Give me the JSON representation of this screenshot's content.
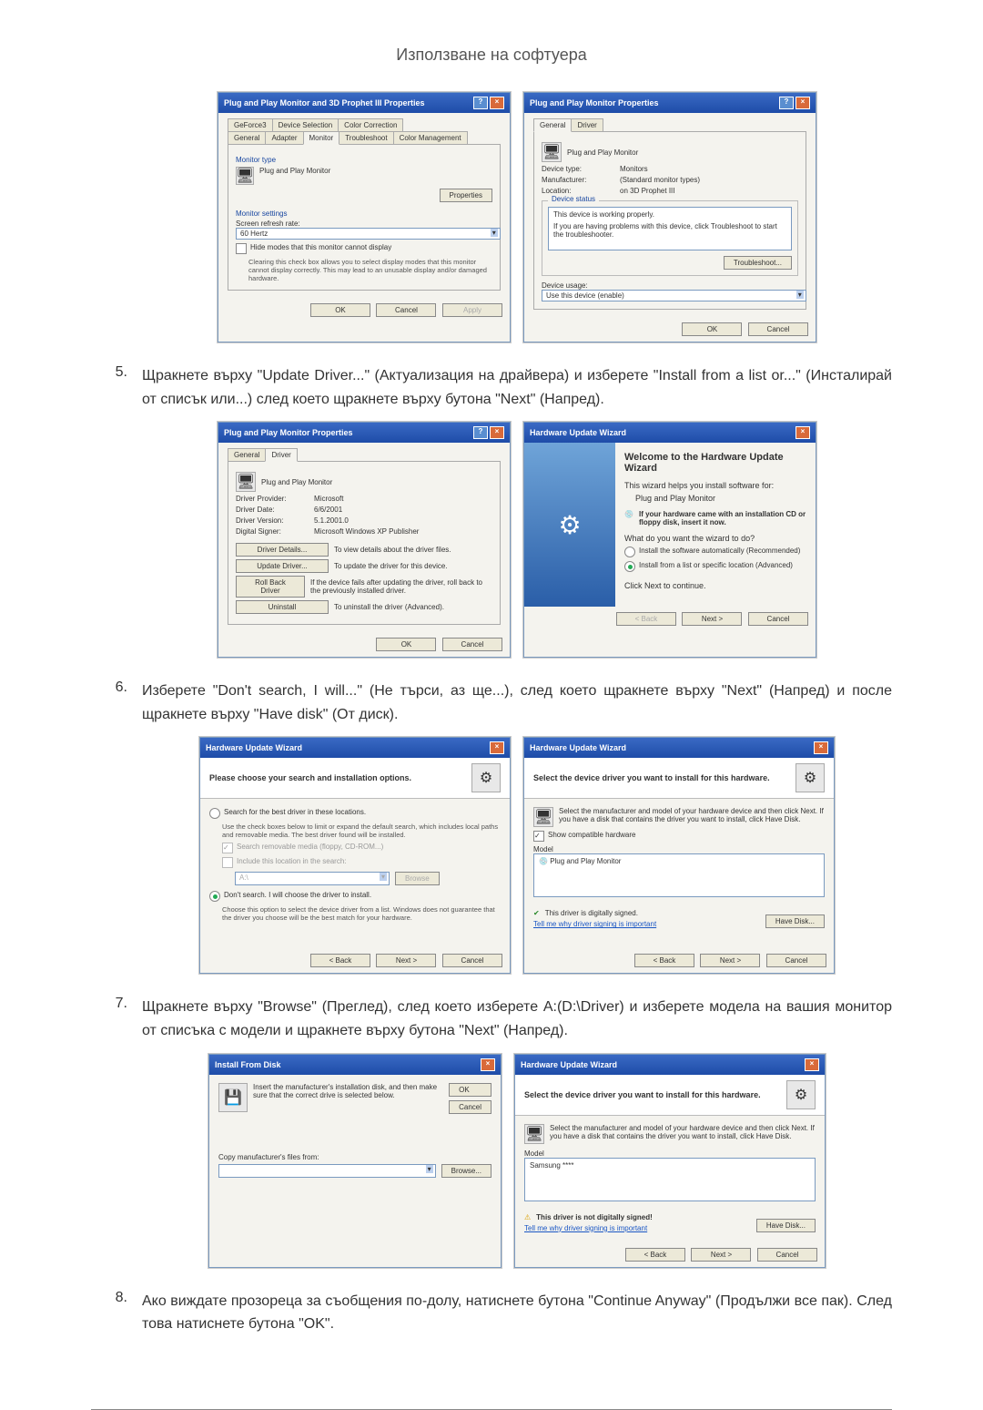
{
  "page_title": "Използване на софтуера",
  "step5": {
    "num": "5.",
    "text": "Щракнете върху \"Update Driver...\" (Актуализация на драйвера) и изберете \"Install from a list or...\" (Инсталирай от списък или...) след което щракнете върху бутона \"Next\" (Напред)."
  },
  "step6": {
    "num": "6.",
    "text": "Изберете \"Don't search, I will...\" (Не търси, аз ще...), след което щракнете върху \"Next\" (Напред) и после щракнете върху \"Have disk\" (От диск)."
  },
  "step7": {
    "num": "7.",
    "text": "Щракнете върху \"Browse\" (Преглед), след което изберете A:(D:\\Driver) и изберете модела на вашия монитор от списъка с модели и щракнете върху бутона \"Next\" (Напред)."
  },
  "step8": {
    "num": "8.",
    "text": "Ако виждате прозореца за съобщения по-долу, натиснете бутона \"Continue Anyway\" (Продължи все пак). След това натиснете бутона \"OK\"."
  },
  "dlg1a": {
    "title": "Plug and Play Monitor and 3D Prophet III Properties",
    "tabs": {
      "geforce": "GeForce3",
      "devsel": "Device Selection",
      "colorcorr": "Color Correction",
      "general": "General",
      "adapter": "Adapter",
      "monitor": "Monitor",
      "troubleshoot": "Troubleshoot",
      "colormgmt": "Color Management"
    },
    "monitor_type_label": "Monitor type",
    "monitor_name": "Plug and Play Monitor",
    "properties_btn": "Properties",
    "monitor_settings_label": "Monitor settings",
    "refresh_label": "Screen refresh rate:",
    "refresh_value": "60 Hertz",
    "hide_modes": "Hide modes that this monitor cannot display",
    "hide_modes_help": "Clearing this check box allows you to select display modes that this monitor cannot display correctly. This may lead to an unusable display and/or damaged hardware.",
    "ok": "OK",
    "cancel": "Cancel",
    "apply": "Apply"
  },
  "dlg1b": {
    "title": "Plug and Play Monitor Properties",
    "tabs": {
      "general": "General",
      "driver": "Driver"
    },
    "name": "Plug and Play Monitor",
    "devtype_l": "Device type:",
    "devtype_v": "Monitors",
    "manu_l": "Manufacturer:",
    "manu_v": "(Standard monitor types)",
    "loc_l": "Location:",
    "loc_v": "on 3D Prophet III",
    "status_label": "Device status",
    "status1": "This device is working properly.",
    "status2": "If you are having problems with this device, click Troubleshoot to start the troubleshooter.",
    "troubleshoot_btn": "Troubleshoot...",
    "usage_label": "Device usage:",
    "usage_value": "Use this device (enable)",
    "ok": "OK",
    "cancel": "Cancel"
  },
  "dlg2a": {
    "title": "Plug and Play Monitor Properties",
    "tabs": {
      "general": "General",
      "driver": "Driver"
    },
    "name": "Plug and Play Monitor",
    "prov_l": "Driver Provider:",
    "prov_v": "Microsoft",
    "date_l": "Driver Date:",
    "date_v": "6/6/2001",
    "ver_l": "Driver Version:",
    "ver_v": "5.1.2001.0",
    "sign_l": "Digital Signer:",
    "sign_v": "Microsoft Windows XP Publisher",
    "details_btn": "Driver Details...",
    "details_txt": "To view details about the driver files.",
    "update_btn": "Update Driver...",
    "update_txt": "To update the driver for this device.",
    "rollback_btn": "Roll Back Driver",
    "rollback_txt": "If the device fails after updating the driver, roll back to the previously installed driver.",
    "uninstall_btn": "Uninstall",
    "uninstall_txt": "To uninstall the driver (Advanced).",
    "ok": "OK",
    "cancel": "Cancel"
  },
  "dlg2b": {
    "title": "Hardware Update Wizard",
    "welcome": "Welcome to the Hardware Update Wizard",
    "helps": "This wizard helps you install software for:",
    "device": "Plug and Play Monitor",
    "cd_hint": "If your hardware came with an installation CD or floppy disk, insert it now.",
    "want": "What do you want the wizard to do?",
    "opt_auto": "Install the software automatically (Recommended)",
    "opt_list": "Install from a list or specific location (Advanced)",
    "cont": "Click Next to continue.",
    "back": "< Back",
    "next": "Next >",
    "cancel": "Cancel"
  },
  "dlg3a": {
    "title": "Hardware Update Wizard",
    "header": "Please choose your search and installation options.",
    "opt_search": "Search for the best driver in these locations.",
    "opt_search_help": "Use the check boxes below to limit or expand the default search, which includes local paths and removable media. The best driver found will be installed.",
    "cb_media": "Search removable media (floppy, CD-ROM...)",
    "cb_include": "Include this location in the search:",
    "path": "A:\\",
    "browse_btn": "Browse",
    "opt_dont": "Don't search. I will choose the driver to install.",
    "opt_dont_help": "Choose this option to select the device driver from a list. Windows does not guarantee that the driver you choose will be the best match for your hardware.",
    "back": "< Back",
    "next": "Next >",
    "cancel": "Cancel"
  },
  "dlg3b": {
    "title": "Hardware Update Wizard",
    "header": "Select the device driver you want to install for this hardware.",
    "hint": "Select the manufacturer and model of your hardware device and then click Next. If you have a disk that contains the driver you want to install, click Have Disk.",
    "show_compat": "Show compatible hardware",
    "model_label": "Model",
    "model_item": "Plug and Play Monitor",
    "signed": "This driver is digitally signed.",
    "why_link": "Tell me why driver signing is important",
    "have_disk": "Have Disk...",
    "back": "< Back",
    "next": "Next >",
    "cancel": "Cancel"
  },
  "dlg4a": {
    "title": "Install From Disk",
    "hint": "Insert the manufacturer's installation disk, and then make sure that the correct drive is selected below.",
    "ok": "OK",
    "cancel": "Cancel",
    "copy_label": "Copy manufacturer's files from:",
    "path_value": "",
    "browse": "Browse..."
  },
  "dlg4b": {
    "title": "Hardware Update Wizard",
    "header": "Select the device driver you want to install for this hardware.",
    "hint": "Select the manufacturer and model of your hardware device and then click Next. If you have a disk that contains the driver you want to install, click Have Disk.",
    "model_label": "Model",
    "model_item": "Samsung ****",
    "not_signed": "This driver is not digitally signed!",
    "why_link": "Tell me why driver signing is important",
    "have_disk": "Have Disk...",
    "back": "< Back",
    "next": "Next >",
    "cancel": "Cancel"
  }
}
